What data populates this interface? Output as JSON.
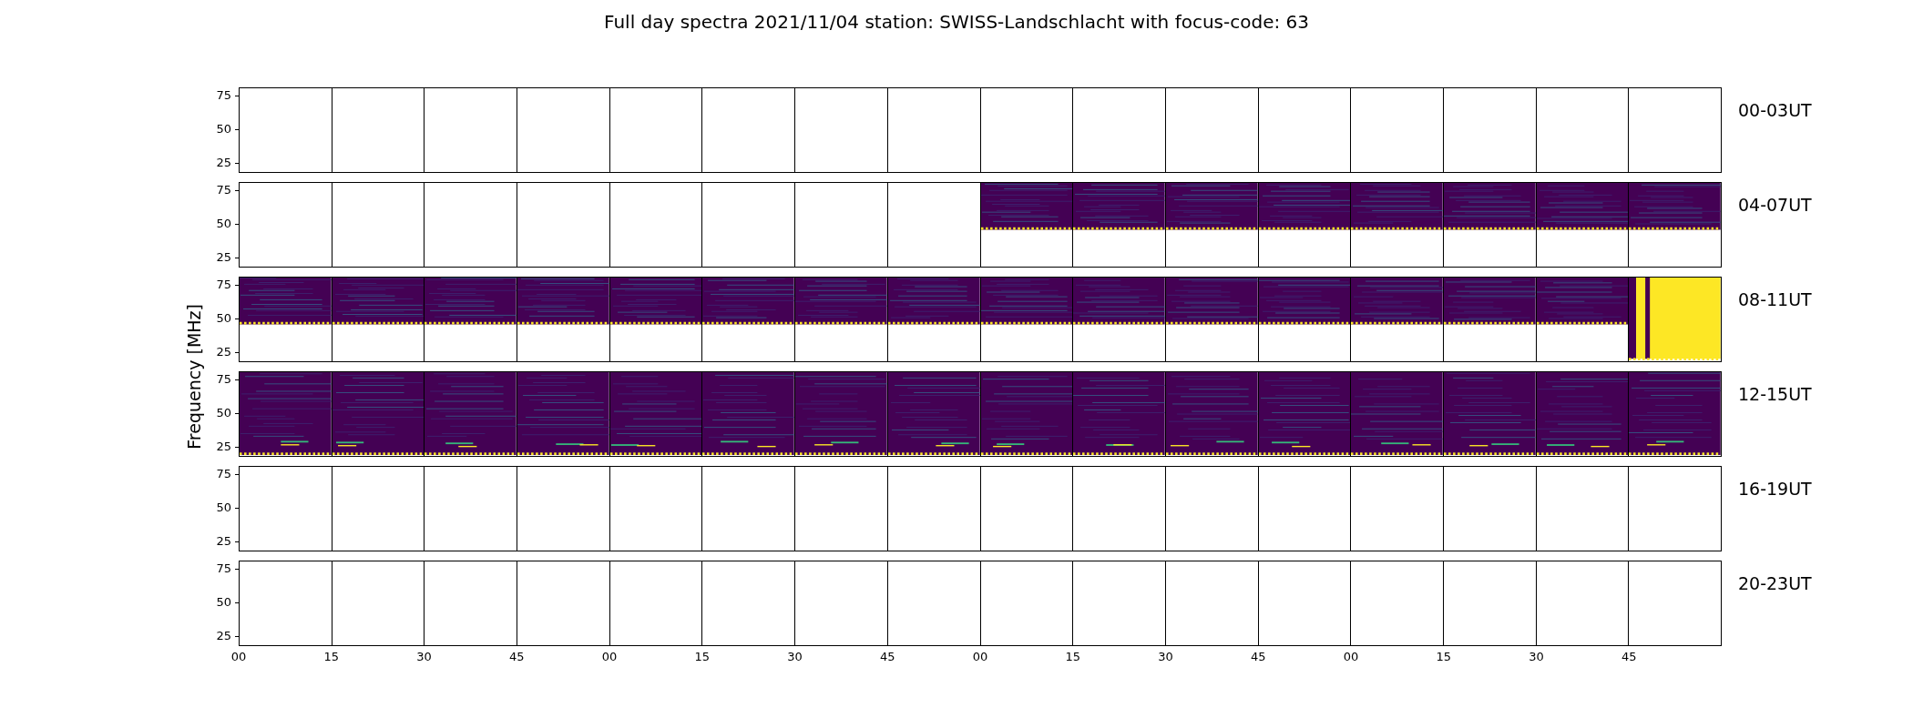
{
  "title": "Full day spectra 2021/11/04 station: SWISS-Landschlacht with focus-code: 63",
  "ylabel": "Frequency [MHz]",
  "xticks": [
    "00",
    "15",
    "30",
    "45",
    "00",
    "15",
    "30",
    "45",
    "00",
    "15",
    "30",
    "45",
    "00",
    "15",
    "30",
    "45"
  ],
  "rows": [
    {
      "label": "00-03UT",
      "yticks": [
        "75",
        "50",
        "25"
      ],
      "panels": [
        {
          "kind": "empty"
        },
        {
          "kind": "empty"
        },
        {
          "kind": "empty"
        },
        {
          "kind": "empty"
        },
        {
          "kind": "empty"
        },
        {
          "kind": "empty"
        },
        {
          "kind": "empty"
        },
        {
          "kind": "empty"
        },
        {
          "kind": "empty"
        },
        {
          "kind": "empty"
        },
        {
          "kind": "empty"
        },
        {
          "kind": "empty"
        },
        {
          "kind": "empty"
        },
        {
          "kind": "empty"
        },
        {
          "kind": "empty"
        },
        {
          "kind": "empty"
        }
      ]
    },
    {
      "label": "04-07UT",
      "yticks": [
        "75",
        "50",
        "25"
      ],
      "panels": [
        {
          "kind": "empty"
        },
        {
          "kind": "empty"
        },
        {
          "kind": "empty"
        },
        {
          "kind": "empty"
        },
        {
          "kind": "empty"
        },
        {
          "kind": "empty"
        },
        {
          "kind": "empty"
        },
        {
          "kind": "empty"
        },
        {
          "kind": "upper"
        },
        {
          "kind": "upper"
        },
        {
          "kind": "upper"
        },
        {
          "kind": "upper"
        },
        {
          "kind": "upper"
        },
        {
          "kind": "upper"
        },
        {
          "kind": "upper"
        },
        {
          "kind": "upper"
        }
      ]
    },
    {
      "label": "08-11UT",
      "yticks": [
        "75",
        "50",
        "25"
      ],
      "panels": [
        {
          "kind": "upper"
        },
        {
          "kind": "upper"
        },
        {
          "kind": "upper"
        },
        {
          "kind": "upper"
        },
        {
          "kind": "upper"
        },
        {
          "kind": "upper"
        },
        {
          "kind": "upper"
        },
        {
          "kind": "upper"
        },
        {
          "kind": "upper"
        },
        {
          "kind": "upper"
        },
        {
          "kind": "upper"
        },
        {
          "kind": "upper"
        },
        {
          "kind": "upper"
        },
        {
          "kind": "upper"
        },
        {
          "kind": "upper"
        },
        {
          "kind": "saturated"
        }
      ]
    },
    {
      "label": "12-15UT",
      "yticks": [
        "75",
        "50",
        "25"
      ],
      "panels": [
        {
          "kind": "full"
        },
        {
          "kind": "full"
        },
        {
          "kind": "full"
        },
        {
          "kind": "full"
        },
        {
          "kind": "full"
        },
        {
          "kind": "full"
        },
        {
          "kind": "full"
        },
        {
          "kind": "full"
        },
        {
          "kind": "full"
        },
        {
          "kind": "full"
        },
        {
          "kind": "full"
        },
        {
          "kind": "full"
        },
        {
          "kind": "full"
        },
        {
          "kind": "full"
        },
        {
          "kind": "full"
        },
        {
          "kind": "full"
        }
      ]
    },
    {
      "label": "16-19UT",
      "yticks": [
        "75",
        "50",
        "25"
      ],
      "panels": [
        {
          "kind": "empty"
        },
        {
          "kind": "empty"
        },
        {
          "kind": "empty"
        },
        {
          "kind": "empty"
        },
        {
          "kind": "empty"
        },
        {
          "kind": "empty"
        },
        {
          "kind": "empty"
        },
        {
          "kind": "empty"
        },
        {
          "kind": "empty"
        },
        {
          "kind": "empty"
        },
        {
          "kind": "empty"
        },
        {
          "kind": "empty"
        },
        {
          "kind": "empty"
        },
        {
          "kind": "empty"
        },
        {
          "kind": "empty"
        },
        {
          "kind": "empty"
        }
      ]
    },
    {
      "label": "20-23UT",
      "yticks": [
        "75",
        "50",
        "25"
      ],
      "panels": [
        {
          "kind": "empty"
        },
        {
          "kind": "empty"
        },
        {
          "kind": "empty"
        },
        {
          "kind": "empty"
        },
        {
          "kind": "empty"
        },
        {
          "kind": "empty"
        },
        {
          "kind": "empty"
        },
        {
          "kind": "empty"
        },
        {
          "kind": "empty"
        },
        {
          "kind": "empty"
        },
        {
          "kind": "empty"
        },
        {
          "kind": "empty"
        },
        {
          "kind": "empty"
        },
        {
          "kind": "empty"
        },
        {
          "kind": "empty"
        },
        {
          "kind": "empty"
        }
      ]
    }
  ]
}
